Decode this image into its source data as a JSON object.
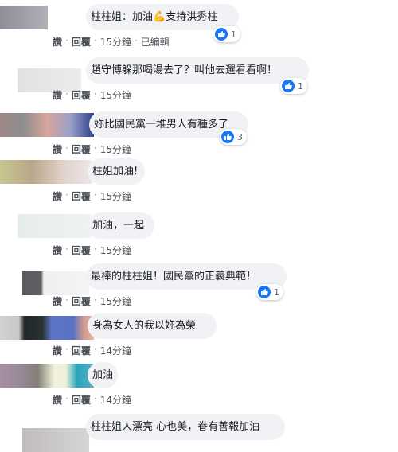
{
  "colors": {
    "bubble": "#f0f2f5",
    "like_blue": "#1877f2",
    "action_text": "#4b4f56"
  },
  "icons": {
    "like": "thumbs-up-icon",
    "flex": "flexed-biceps-emoji"
  },
  "comments": [
    {
      "text_before": "柱柱姐：加油",
      "emoji": "💪",
      "text_after": "支持洪秀柱",
      "reaction_count": "1",
      "like": "讚",
      "reply": "回覆",
      "time": "15分鐘",
      "edited": "已編輯"
    },
    {
      "text": "趙守博躲那喝湯去了？叫他去選看看啊！",
      "reaction_count": "1",
      "like": "讚",
      "reply": "回覆",
      "time": "15分鐘"
    },
    {
      "text": "妳比國民黨一堆男人有種多了",
      "reaction_count": "3",
      "like": "讚",
      "reply": "回覆",
      "time": "15分鐘"
    },
    {
      "text": "柱姐加油!",
      "like": "讚",
      "reply": "回覆",
      "time": "15分鐘"
    },
    {
      "text": "加油，一起",
      "like": "讚",
      "reply": "回覆",
      "time": "15分鐘"
    },
    {
      "text": "最棒的柱柱姐！國民黨的正義典範！",
      "reaction_count": "1",
      "like": "讚",
      "reply": "回覆",
      "time": "15分鐘"
    },
    {
      "text": "身為女人的我以妳為榮",
      "like": "讚",
      "reply": "回覆",
      "time": "14分鐘"
    },
    {
      "text": "加油",
      "like": "讚",
      "reply": "回覆",
      "time": "14分鐘"
    },
    {
      "text": "柱柱姐人漂亮 心也美，眷有善報加油"
    }
  ]
}
